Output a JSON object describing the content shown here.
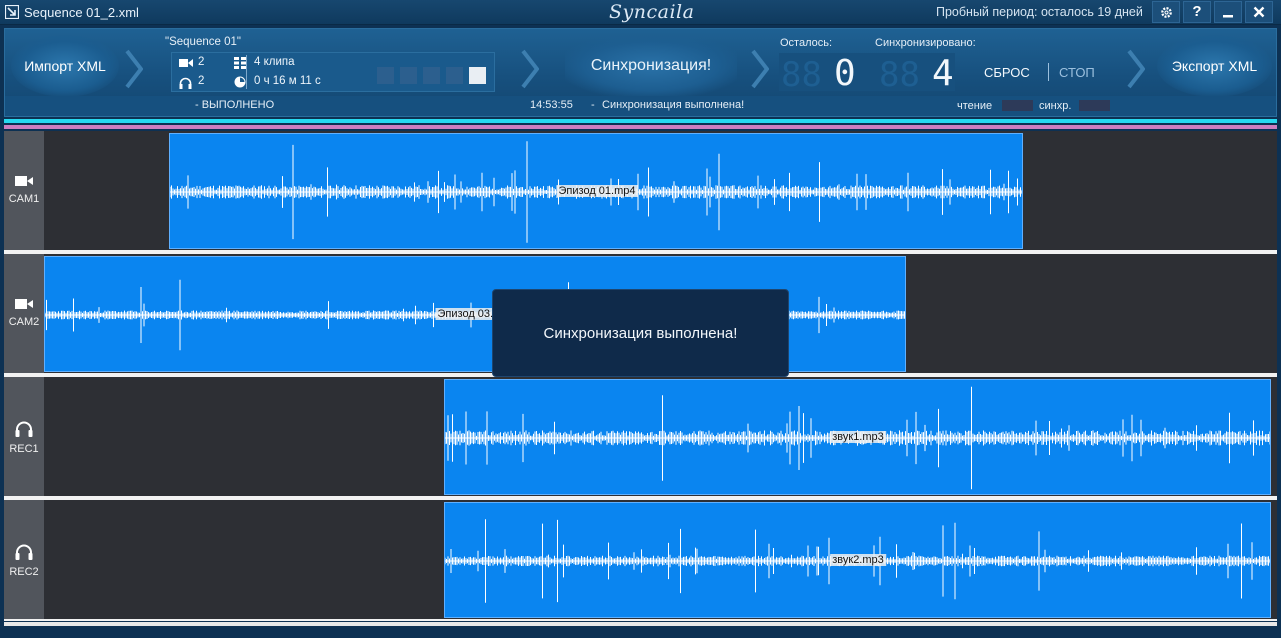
{
  "titlebar": {
    "file_title": "Sequence 01_2.xml",
    "logo_text": "Syncaila",
    "trial_text": "Пробный период: осталось 19 дней",
    "help_label": "?"
  },
  "toolbar": {
    "import_label": "Импорт XML",
    "export_label": "Экспорт XML",
    "sequence_name": "\"Sequence 01\"",
    "video_count": "2",
    "audio_count": "2",
    "clips_text": "4 клипа",
    "duration_text": "0 ч 16 м 11 с",
    "sync_label": "Синхронизация!",
    "remaining_label": "Осталось:",
    "synced_label": "Синхронизировано:",
    "remaining_value": "0",
    "synced_value": "4",
    "reset_label": "СБРОС",
    "stop_label": "СТОП",
    "status_left": "- ВЫПОЛНЕНО",
    "status_time": "14:53:55",
    "status_dash": "-",
    "status_message": "Синхронизация выполнена!",
    "read_label": "чтение",
    "sync_bar_label": "синхр."
  },
  "tracks": [
    {
      "name": "CAM1",
      "icon": "video-camera-icon",
      "clip_label": "Эпизод 01.mp4"
    },
    {
      "name": "CAM2",
      "icon": "video-camera-icon",
      "clip_label": "Эпизод 03.mp4"
    },
    {
      "name": "REC1",
      "icon": "headphones-icon",
      "clip_label": "звук1.mp3"
    },
    {
      "name": "REC2",
      "icon": "headphones-icon",
      "clip_label": "звук2.mp3"
    }
  ],
  "toast": {
    "message": "Синхронизация выполнена!"
  },
  "colors": {
    "clip_fill": "#0a85f0",
    "track_bg": "#2d2f34",
    "accent_cyan": "#27d9f0",
    "accent_pink": "#cd7ec0"
  }
}
